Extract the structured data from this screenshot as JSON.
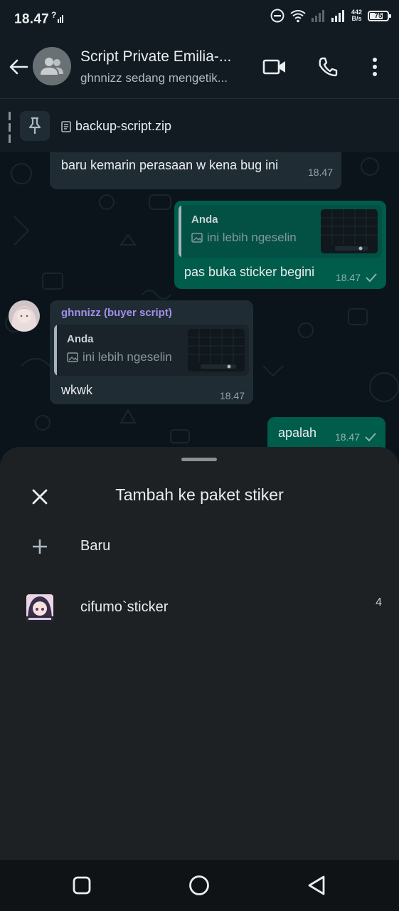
{
  "status_bar": {
    "time": "18.47",
    "time_badge": "?",
    "net_speed_value": "442",
    "net_speed_unit": "B/s",
    "battery_percent": 75,
    "battery_label": "75"
  },
  "header": {
    "title": "Script Private Emilia-...",
    "subtitle": "ghnnizz sedang mengetik...",
    "icons": [
      "back-arrow-icon",
      "group-icon",
      "video-call-icon",
      "voice-call-icon",
      "more-vert-icon"
    ]
  },
  "pinned": {
    "file_name": "backup-script.zip"
  },
  "messages": [
    {
      "direction": "in",
      "text": "baru kemarin perasaan w kena bug ini",
      "time": "18.47"
    },
    {
      "direction": "out",
      "quote_author": "Anda",
      "quote_text": "ini lebih ngeselin",
      "text": "pas buka sticker begini",
      "time": "18.47",
      "status": "sent"
    },
    {
      "direction": "in",
      "sender": "ghnnizz (buyer script)",
      "quote_author": "Anda",
      "quote_text": "ini lebih ngeselin",
      "text": "wkwk",
      "time": "18.47"
    },
    {
      "direction": "out",
      "text": "apalah",
      "time": "18.47",
      "status": "sent"
    }
  ],
  "sheet": {
    "title": "Tambah ke paket stiker",
    "new_label": "Baru",
    "packs": [
      {
        "name": "cifumo`sticker",
        "count": "4"
      }
    ]
  },
  "colors": {
    "background": "#0b141a",
    "header": "#121b22",
    "incoming_bubble": "#202c33",
    "outgoing_bubble": "#005c4b",
    "sender_name": "#a38ee8",
    "sheet": "#1e2124"
  }
}
